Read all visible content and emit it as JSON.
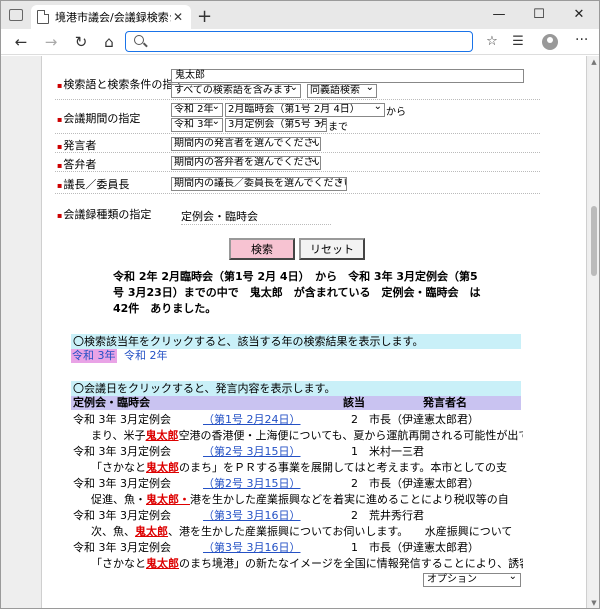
{
  "browser": {
    "tab_title": "境港市議会/会議録検索システム",
    "tab_close": "✕",
    "new_tab": "+",
    "minimize": "—",
    "maximize": "☐",
    "close": "✕",
    "back": "←",
    "forward": "→",
    "refresh": "↻",
    "home": "⌂",
    "address_value": "",
    "star_icon": "☆",
    "favorites_icon": "☰",
    "collections_icon": "⧉",
    "more_icon": "···"
  },
  "search": {
    "keyword_label": "検索語と検索条件の指定",
    "keyword_value": "鬼太郎",
    "condition_select": "すべての検索語を含みます",
    "synonym_select": "同義語検索",
    "period_label": "会議期間の指定",
    "from_year": "令和 2年",
    "from_session": "2月臨時会（第1号 2月 4日）",
    "from_suffix": "から",
    "to_year": "令和 3年",
    "to_session": "3月定例会（第5号 3月23日）",
    "to_suffix": "まで",
    "speaker_label": "発言者",
    "speaker_select": "期間内の発言者を選んでください",
    "answerer_label": "答弁者",
    "answerer_select": "期間内の答弁者を選んでください",
    "chair_label": "議長／委員長",
    "chair_select": "期間内の議長／委員長を選んでください",
    "type_label": "会議録種類の指定",
    "type_value": "定例会・臨時会",
    "search_button": "検索",
    "reset_button": "リセット"
  },
  "summary": {
    "line1": "令和 2年 2月臨時会（第1号 2月 4日）　から　令和 3年 3月定例会（第5",
    "line2": "号 3月23日）までの中で　鬼太郎　が含まれている　定例会・臨時会　は",
    "line3": "42件　ありました。"
  },
  "year_section": {
    "info": "〇検索該当年をクリックすると、該当する年の検索結果を表示します。",
    "years": [
      "令和 3年",
      "令和 2年"
    ]
  },
  "results": {
    "info": "〇会議日をクリックすると、発言内容を表示します。",
    "col_meeting": "定例会・臨時会",
    "col_no": "該当",
    "col_speaker": "発言者名",
    "rows": [
      {
        "meeting": "令和 3年 3月定例会",
        "date": "（第1号 2月24日）",
        "count": "2",
        "speaker": "市長（伊達憲太郎君）",
        "excerpt_pre": "まり、米子",
        "excerpt_kw": "鬼太郎",
        "excerpt_post": "空港の香港便・上海便についても、夏から運航再開される可能性が出て"
      },
      {
        "meeting": "令和 3年 3月定例会",
        "date": "（第2号 3月15日）",
        "count": "1",
        "speaker": "米村一三君",
        "excerpt_pre": "「さかなと",
        "excerpt_kw": "鬼太郎",
        "excerpt_post": "のまち」をＰＲする事業を展開してはと考えます。本市としての支"
      },
      {
        "meeting": "令和 3年 3月定例会",
        "date": "（第2号 3月15日）",
        "count": "2",
        "speaker": "市長（伊達憲太郎君）",
        "excerpt_pre": "促進、魚・",
        "excerpt_kw": "鬼太郎・",
        "excerpt_post": "港を生かした産業振興などを着実に進めることにより税収等の自"
      },
      {
        "meeting": "令和 3年 3月定例会",
        "date": "（第3号 3月16日）",
        "count": "2",
        "speaker": "荒井秀行君",
        "excerpt_pre": "次、魚、",
        "excerpt_kw": "鬼太郎",
        "excerpt_post": "、港を生かした産業振興についてお伺いします。　　水産振興について"
      },
      {
        "meeting": "令和 3年 3月定例会",
        "date": "（第3号 3月16日）",
        "count": "1",
        "speaker": "市長（伊達憲太郎君）",
        "excerpt_pre": "「さかなと",
        "excerpt_kw": "鬼太郎",
        "excerpt_post": "のまち境港」の新たなイメージを全国に情報発信することにより、誘客"
      }
    ]
  },
  "option_select": "オプション"
}
